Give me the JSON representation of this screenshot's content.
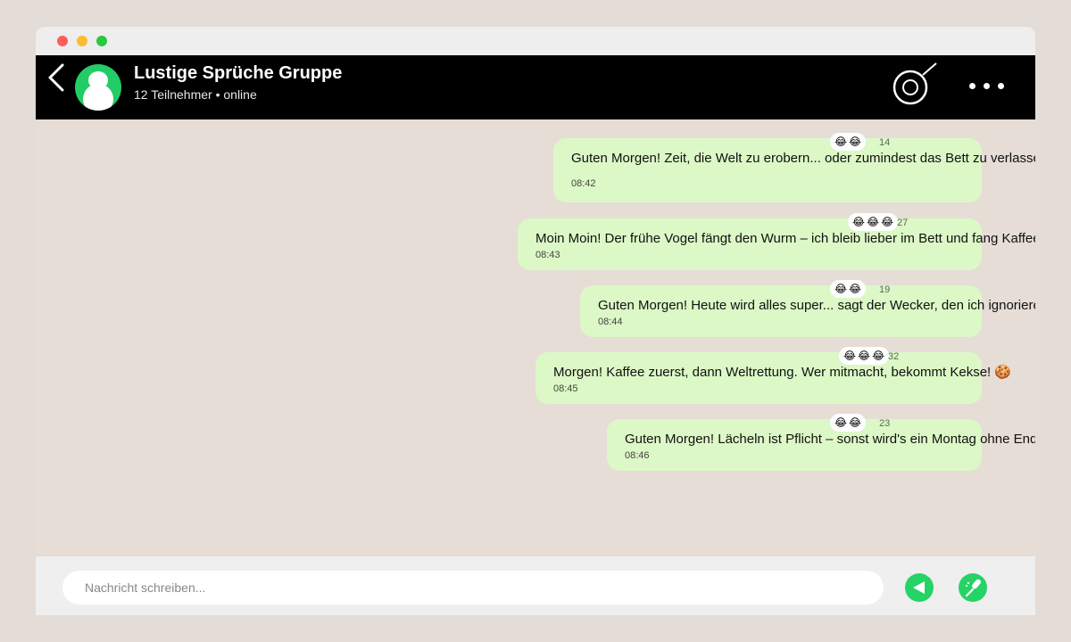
{
  "header": {
    "title": "Lustige Sprüche Gruppe",
    "subtitle": "12 Teilnehmer • online",
    "icons": {
      "back": "back-arrow-icon",
      "search": "search-icon",
      "more": "more-dots-icon"
    }
  },
  "messages": [
    {
      "text": "Guten Morgen! Zeit, die Welt zu erobern... oder zumindest das Bett zu verlassen! ☕",
      "time": "08:42",
      "reactions": [
        "😂",
        "😂"
      ],
      "reaction_count": "14"
    },
    {
      "text": "Moin Moin! Der frühe Vogel fängt den Wurm – ich bleib lieber im Bett und fang Kaffee! 😂",
      "time": "08:43",
      "reactions": [
        "😂",
        "😂",
        "😂"
      ],
      "reaction_count": "27"
    },
    {
      "text": "Guten Morgen! Heute wird alles super... sagt der Wecker, den ich ignoriere! 💣",
      "time": "08:44",
      "reactions": [
        "😂",
        "😂"
      ],
      "reaction_count": "19"
    },
    {
      "text": "Morgen! Kaffee zuerst, dann Weltrettung. Wer mitmacht, bekommt Kekse! 🍪",
      "time": "08:45",
      "reactions": [
        "😂",
        "😂",
        "😂"
      ],
      "reaction_count": "32"
    },
    {
      "text": "Guten Morgen! Lächeln ist Pflicht – sonst wird's ein Montag ohne Ende! 😊",
      "time": "08:46",
      "reactions": [
        "😂",
        "😂"
      ],
      "reaction_count": "23"
    }
  ],
  "composer": {
    "placeholder": "Nachricht schreiben...",
    "icons": {
      "send": "send-icon",
      "mic": "microphone-icon"
    }
  },
  "colors": {
    "header_bg": "#000000",
    "bubble_bg": "#dcf8c6",
    "accent": "#25d366",
    "chat_bg": "#e5ddd6"
  }
}
